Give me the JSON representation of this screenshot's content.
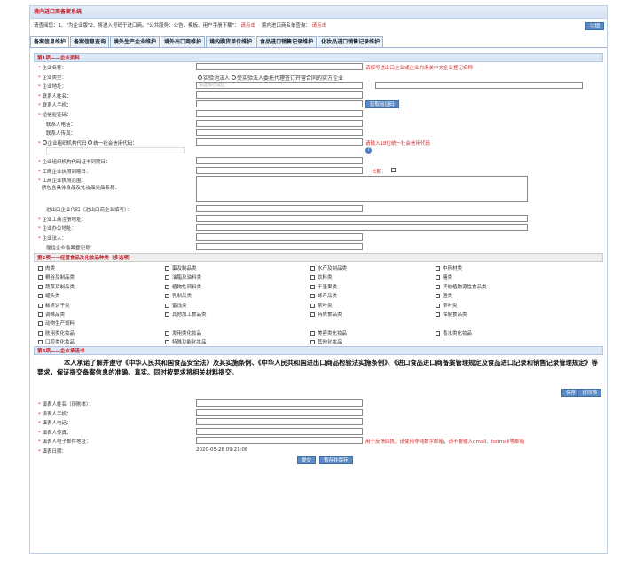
{
  "header": {
    "title": "境内进口商备案系统",
    "notice": "请查阅您：1、\"为企业版\"2、将进入号码于进口商。\"公共服务：公告、模板、用户手册下载\"：",
    "notice_link": "请点击",
    "notice2": "境内进口商名单查询：",
    "notice2_link": "请点击",
    "top_button": "注销"
  },
  "tabs": [
    "备案信息维护",
    "备案信息查询",
    "境外生产企业维护",
    "境外出口商维护",
    "境内购货单位维护",
    "食品进口销售记录维护",
    "化妆品进口销售记录维护"
  ],
  "section1": {
    "title": "第1项——企业资料",
    "fields": [
      {
        "label": "企业名称：",
        "required": true,
        "hint": "请填写进出口企业或企业的海关中文企业登记名称",
        "indent": false
      },
      {
        "label": "企业类型：",
        "required": true,
        "indent": false
      },
      {
        "label": "企业地址：",
        "required": true,
        "placeholder": "请选择行政区",
        "indent": false
      },
      {
        "label": "联系人姓名：",
        "required": true,
        "indent": false
      },
      {
        "label": "联系人手机：",
        "required": true,
        "button": "获取验证码",
        "indent": false
      },
      {
        "label": "短信验证码：",
        "required": true,
        "indent": false
      },
      {
        "label": "联系人电话：",
        "required": false,
        "indent": true
      },
      {
        "label": "联系人传真：",
        "required": false,
        "indent": true
      }
    ],
    "radio1": "实验池法人",
    "radio2": "受实验法人委托代理签订开营合同的实方企业",
    "code_radio1": "企业组织机构代码",
    "code_radio2": "统一社会信用代码：",
    "code_hint": "请输入18位统一社会信用代码",
    "fields2": [
      {
        "label": "企业组织机构代码证书到期日：",
        "required": true,
        "indent": false
      },
      {
        "label": "工商企业执照到期日：",
        "required": true,
        "extra": "长期：",
        "indent": false
      }
    ],
    "business_scope_label": "工商企业执照范围：",
    "business_scope_label2": "所包含具体食品及化妆品类品名称：",
    "fields3": [
      {
        "label": "进出口企业代码（进出口商企业填写）：",
        "required": false,
        "indent": true
      },
      {
        "label": "企业工商注册地址：",
        "required": true,
        "indent": false
      },
      {
        "label": "企业办公地址：",
        "required": true,
        "indent": false
      },
      {
        "label": "企业法人：",
        "required": true,
        "indent": false
      },
      {
        "label": "居住企业备案登记号：",
        "required": false,
        "indent": true
      }
    ]
  },
  "section2": {
    "title": "第2项——经营食品及化妆品种类（多选项）",
    "categories": [
      [
        "肉类",
        "蛋及制品类",
        "水产及制品类",
        "中药材类"
      ],
      [
        "粮谷及制品类",
        "油脂及油料类",
        "饮料类",
        "糖类"
      ],
      [
        "蔬菜及制品类",
        "植物性调料类",
        "干坚果类",
        "其他植物源性食品类"
      ],
      [
        "罐头类",
        "乳制品类",
        "蜂产品类",
        "酒类"
      ],
      [
        "糕点饼干类",
        "蜜饯类",
        "茶叶类",
        "茶叶类"
      ],
      [
        "调味品类",
        "其他加工食品类",
        "特殊食品类",
        "保健食品类"
      ],
      [
        "动物生产饲料"
      ],
      [
        "肤用类化妆品",
        "发用类化妆品",
        "美容类化妆品",
        "香水类化妆品"
      ],
      [
        "口腔类化妆品",
        "特殊功能化妆品",
        "其他化妆品"
      ]
    ]
  },
  "section3": {
    "title": "第3项——企业承诺书",
    "commitment": "本人承诺了解并遵守《中华人民共和国食品安全法》及其实施条例、《中华人民共和国进出口商品检验法实施条例》、《进口食品进口商备案管理规定及食品进口记录和销售记录管理规定》等要求，保证提交备案信息的准确、真实。同时按要求将相关材料提交。",
    "buttons": [
      "保存",
      "打印预"
    ],
    "fields": [
      {
        "label": "填表人姓名（印刷体）：",
        "required": true
      },
      {
        "label": "填表人手机：",
        "required": true
      },
      {
        "label": "填表人电话：",
        "required": true
      },
      {
        "label": "填表人传真：",
        "required": true
      },
      {
        "label": "填表人电子邮件地址：",
        "required": true,
        "hint": "用于反馈回执、请使用非纯数字邮箱，请不要输入qmail、hotmail等邮箱"
      },
      {
        "label": "填表日期：",
        "required": true,
        "value": "2020-05-28 09:21:08"
      }
    ]
  },
  "bottom_buttons": [
    "提交",
    "暂存并保存"
  ],
  "colors": {
    "title_red": "#c0202a",
    "button_blue": "#5b8bc6",
    "section_bg": "#dde8f6"
  }
}
